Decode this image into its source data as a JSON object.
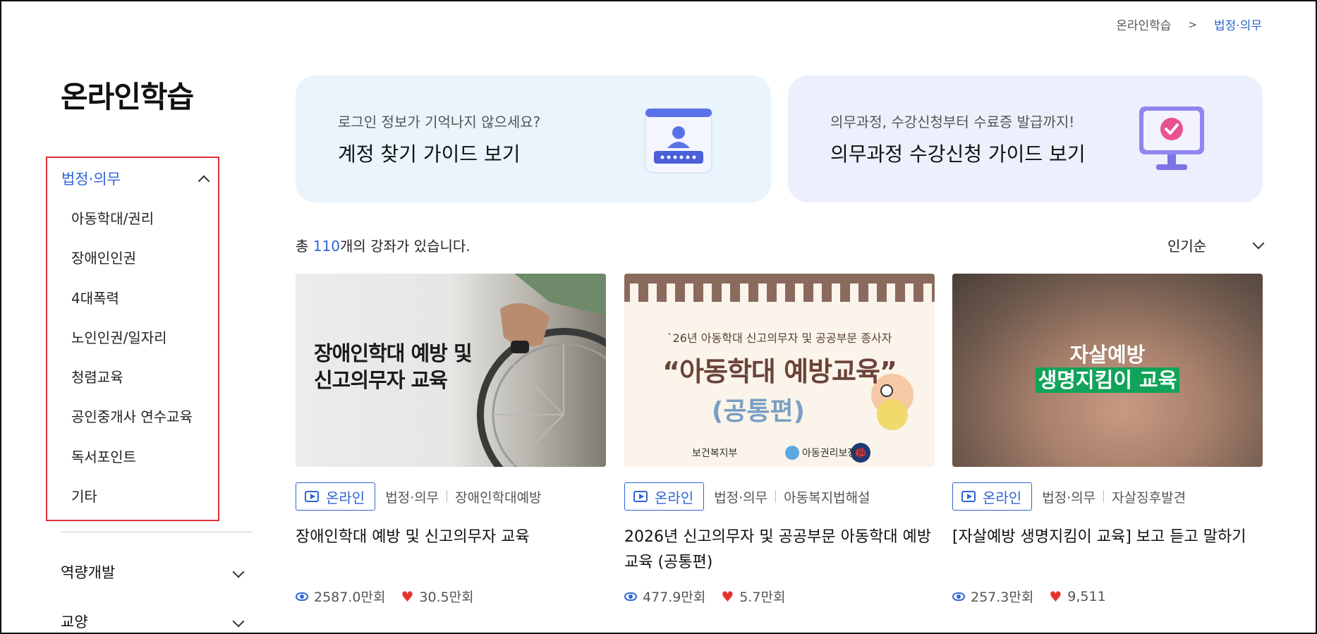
{
  "breadcrumb": {
    "root": "온라인학습",
    "separator": ">",
    "current": "법정·의무"
  },
  "page_title": "온라인학습",
  "sidebar": {
    "active_group": {
      "label": "법정·의무",
      "items": [
        "아동학대/권리",
        "장애인인권",
        "4대폭력",
        "노인인권/일자리",
        "청렴교육",
        "공인중개사 연수교육",
        "독서포인트",
        "기타"
      ]
    },
    "groups": [
      {
        "label": "역량개발"
      },
      {
        "label": "교양"
      }
    ]
  },
  "banners": [
    {
      "subtitle": "로그인 정보가 기억나지 않으세요?",
      "title": "계정 찾기 가이드 보기",
      "icon": "account-password-icon"
    },
    {
      "subtitle": "의무과정, 수강신청부터 수료증 발급까지!",
      "title": "의무과정 수강신청 가이드 보기",
      "icon": "monitor-check-icon"
    }
  ],
  "course_count": {
    "prefix": "총 ",
    "number": "110",
    "suffix": "개의 강좌가 있습니다."
  },
  "sort": {
    "selected": "인기순"
  },
  "cards": [
    {
      "thumb_text_line1": "장애인학대 예방 및",
      "thumb_text_line2": "신고의무자 교육",
      "badge": "온라인",
      "category": "법정·의무",
      "tag": "장애인학대예방",
      "title": "장애인학대 예방 및 신고의무자 교육",
      "views": "2587.0만회",
      "likes": "30.5만회"
    },
    {
      "thumb_small": "`26년 아동학대 신고의무자 및 공공부문 종사자",
      "thumb_big": "“아동학대 예방교육”",
      "thumb_paren": "(공통편)",
      "thumb_logo1": "보건복지부",
      "thumb_logo2": "아동권리보장원",
      "badge": "온라인",
      "category": "법정·의무",
      "tag": "아동복지법해설",
      "title": "2026년 신고의무자 및 공공부문 아동학대 예방교육 (공통편)",
      "views": "477.9만회",
      "likes": "5.7만회"
    },
    {
      "thumb_text_line1": "자살예방",
      "thumb_text_line2": "생명지킴이 교육",
      "badge": "온라인",
      "category": "법정·의무",
      "tag": "자살징후발견",
      "title": "[자살예방 생명지킴이 교육] 보고 듣고 말하기",
      "views": "257.3만회",
      "likes": "9,511"
    }
  ],
  "colors": {
    "accent": "#2f64d6",
    "heart": "#e8322f",
    "banner1_bg": "#e9f4fc",
    "banner2_bg": "#ecf0fd",
    "highlight_box": "#e0303a"
  }
}
